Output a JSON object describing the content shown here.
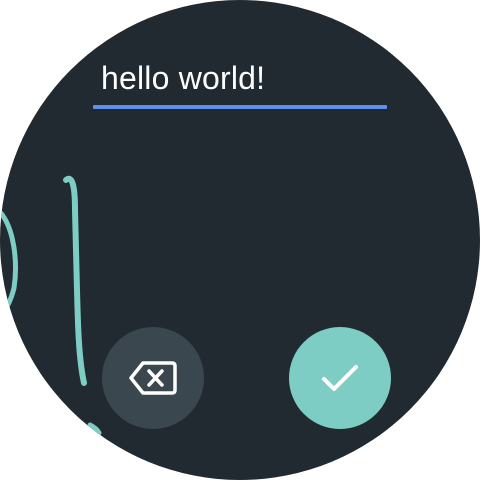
{
  "keyboard": {
    "input": {
      "value": "hello world!"
    },
    "buttons": {
      "delete": {
        "icon": "backspace-icon"
      },
      "confirm": {
        "icon": "check-icon"
      }
    }
  },
  "colors": {
    "background": "#212a30",
    "underline": "#5b8ff0",
    "ink": "#7ecdc5",
    "delete_button": "#3b474f",
    "confirm_button": "#7ecdc5"
  }
}
